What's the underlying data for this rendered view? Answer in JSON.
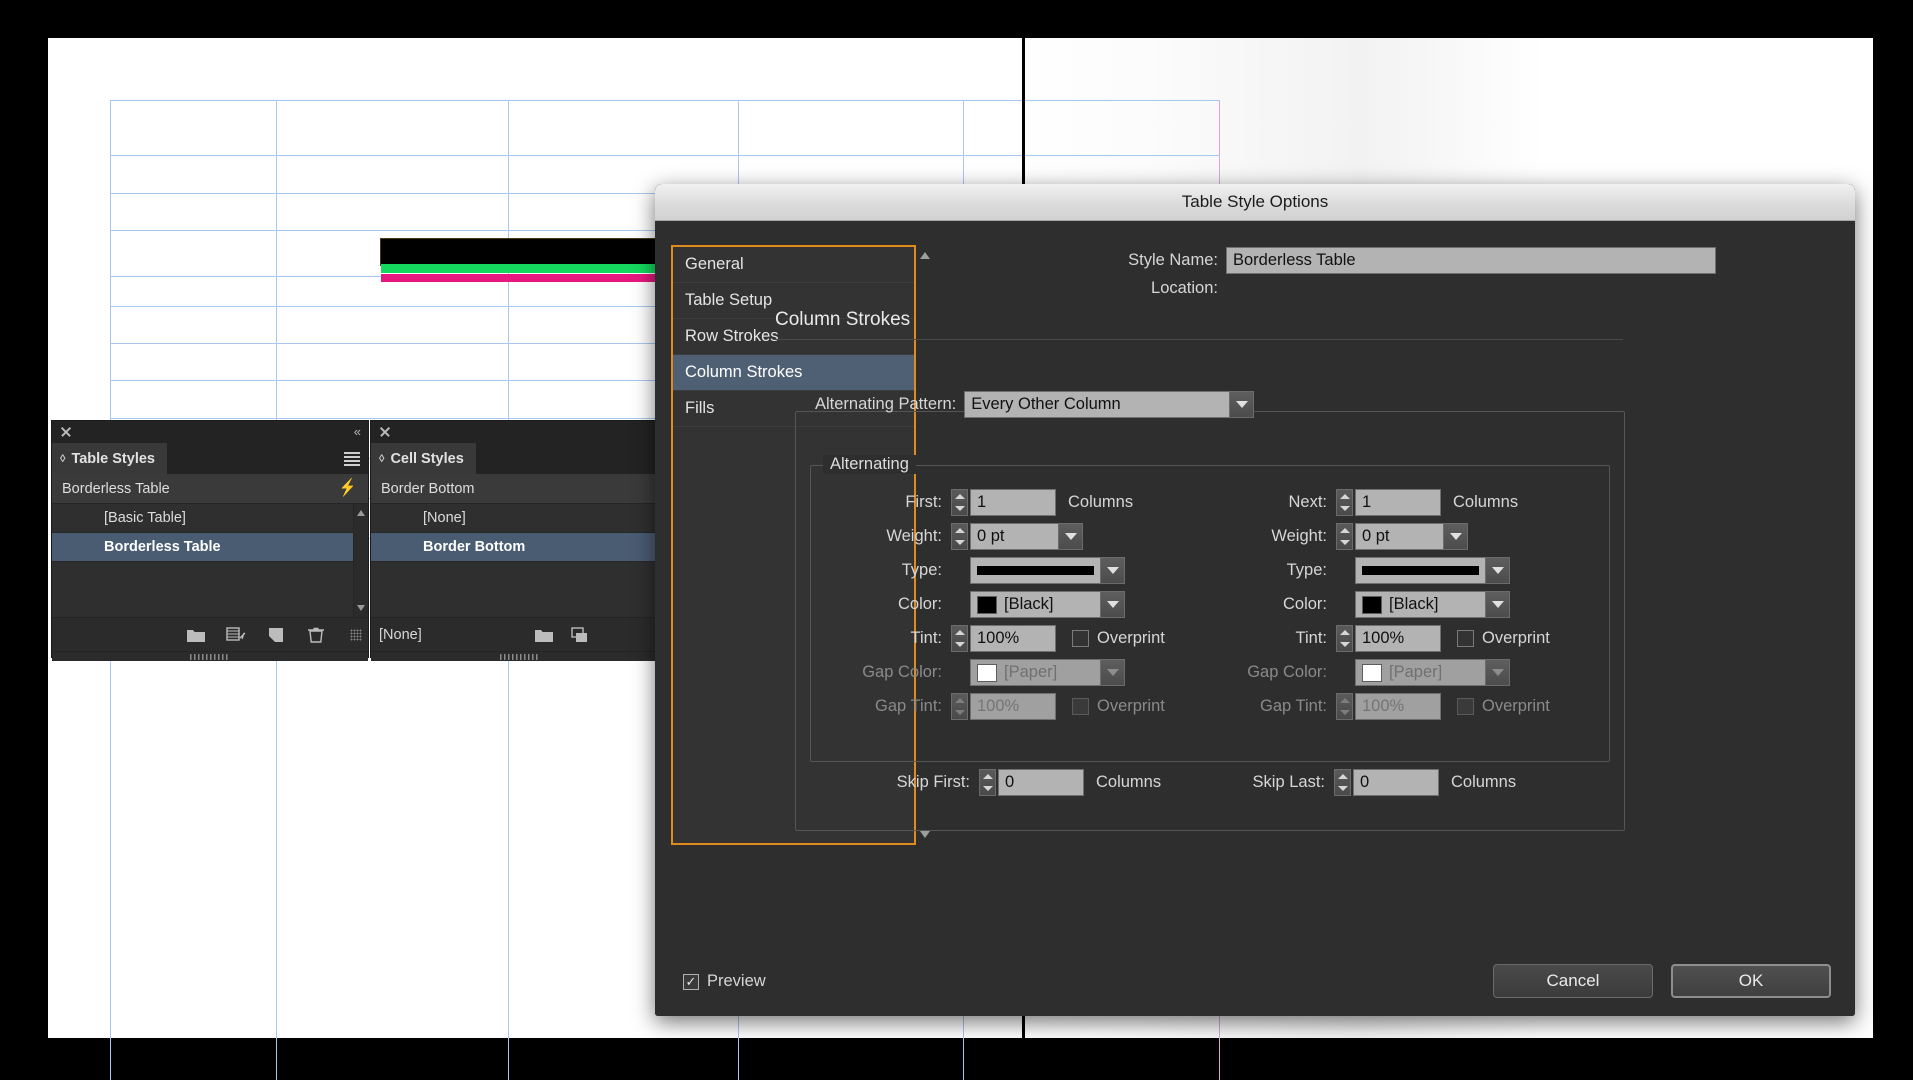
{
  "document": {
    "canvas_name": "indesign-document-canvas",
    "guides_color": "#a9c8ee",
    "margin_color": "#d060c0",
    "cell_fill_color": "#000000",
    "cell_stroke_green": "#15d85f",
    "cell_stroke_magenta": "#e8177f"
  },
  "panels": {
    "table_styles": {
      "tab_label": "Table Styles",
      "current_style": "Borderless Table",
      "items": [
        {
          "label": "[Basic Table]",
          "selected": false
        },
        {
          "label": "Borderless Table",
          "selected": true
        }
      ],
      "footer_icons": [
        "new-style-group-icon",
        "clear-overrides-icon",
        "new-style-icon",
        "delete-style-icon"
      ]
    },
    "cell_styles": {
      "tab_label": "Cell Styles",
      "current_style": "Border Bottom",
      "items": [
        {
          "label": "[None]",
          "selected": false
        },
        {
          "label": "Border Bottom",
          "selected": true
        }
      ],
      "footer_label": "[None]",
      "footer_icons": [
        "new-style-group-icon",
        "clear-overrides-icon"
      ]
    }
  },
  "dialog": {
    "title": "Table Style Options",
    "nav": [
      {
        "label": "General",
        "selected": false
      },
      {
        "label": "Table Setup",
        "selected": false
      },
      {
        "label": "Row Strokes",
        "selected": false
      },
      {
        "label": "Column Strokes",
        "selected": true
      },
      {
        "label": "Fills",
        "selected": false
      }
    ],
    "style_name_label": "Style Name:",
    "style_name_value": "Borderless Table",
    "location_label": "Location:",
    "location_value": "",
    "section_title": "Column Strokes",
    "alternating_pattern_label": "Alternating Pattern:",
    "alternating_pattern_value": "Every Other Column",
    "alternating_group_label": "Alternating",
    "left_column": {
      "first_label": "First:",
      "first_value": "1",
      "first_unit": "Columns",
      "weight_label": "Weight:",
      "weight_value": "0 pt",
      "type_label": "Type:",
      "type_value": "solid-stroke",
      "color_label": "Color:",
      "color_value": "[Black]",
      "color_swatch": "#000000",
      "tint_label": "Tint:",
      "tint_value": "100%",
      "tint_overprint_label": "Overprint",
      "tint_overprint_checked": false,
      "gap_color_label": "Gap Color:",
      "gap_color_value": "[Paper]",
      "gap_color_swatch": "#ffffff",
      "gap_tint_label": "Gap Tint:",
      "gap_tint_value": "100%",
      "gap_tint_overprint_label": "Overprint",
      "gap_tint_overprint_checked": false
    },
    "right_column": {
      "next_label": "Next:",
      "next_value": "1",
      "next_unit": "Columns",
      "weight_label": "Weight:",
      "weight_value": "0 pt",
      "type_label": "Type:",
      "type_value": "solid-stroke",
      "color_label": "Color:",
      "color_value": "[Black]",
      "color_swatch": "#000000",
      "tint_label": "Tint:",
      "tint_value": "100%",
      "tint_overprint_label": "Overprint",
      "tint_overprint_checked": false,
      "gap_color_label": "Gap Color:",
      "gap_color_value": "[Paper]",
      "gap_color_swatch": "#ffffff",
      "gap_tint_label": "Gap Tint:",
      "gap_tint_value": "100%",
      "gap_tint_overprint_label": "Overprint",
      "gap_tint_overprint_checked": false
    },
    "skip_first_label": "Skip First:",
    "skip_first_value": "0",
    "skip_first_unit": "Columns",
    "skip_last_label": "Skip Last:",
    "skip_last_value": "0",
    "skip_last_unit": "Columns",
    "preview_label": "Preview",
    "preview_checked": true,
    "cancel_label": "Cancel",
    "ok_label": "OK",
    "accent_focus_color": "#e08b1e",
    "selection_color": "#4f6074"
  }
}
